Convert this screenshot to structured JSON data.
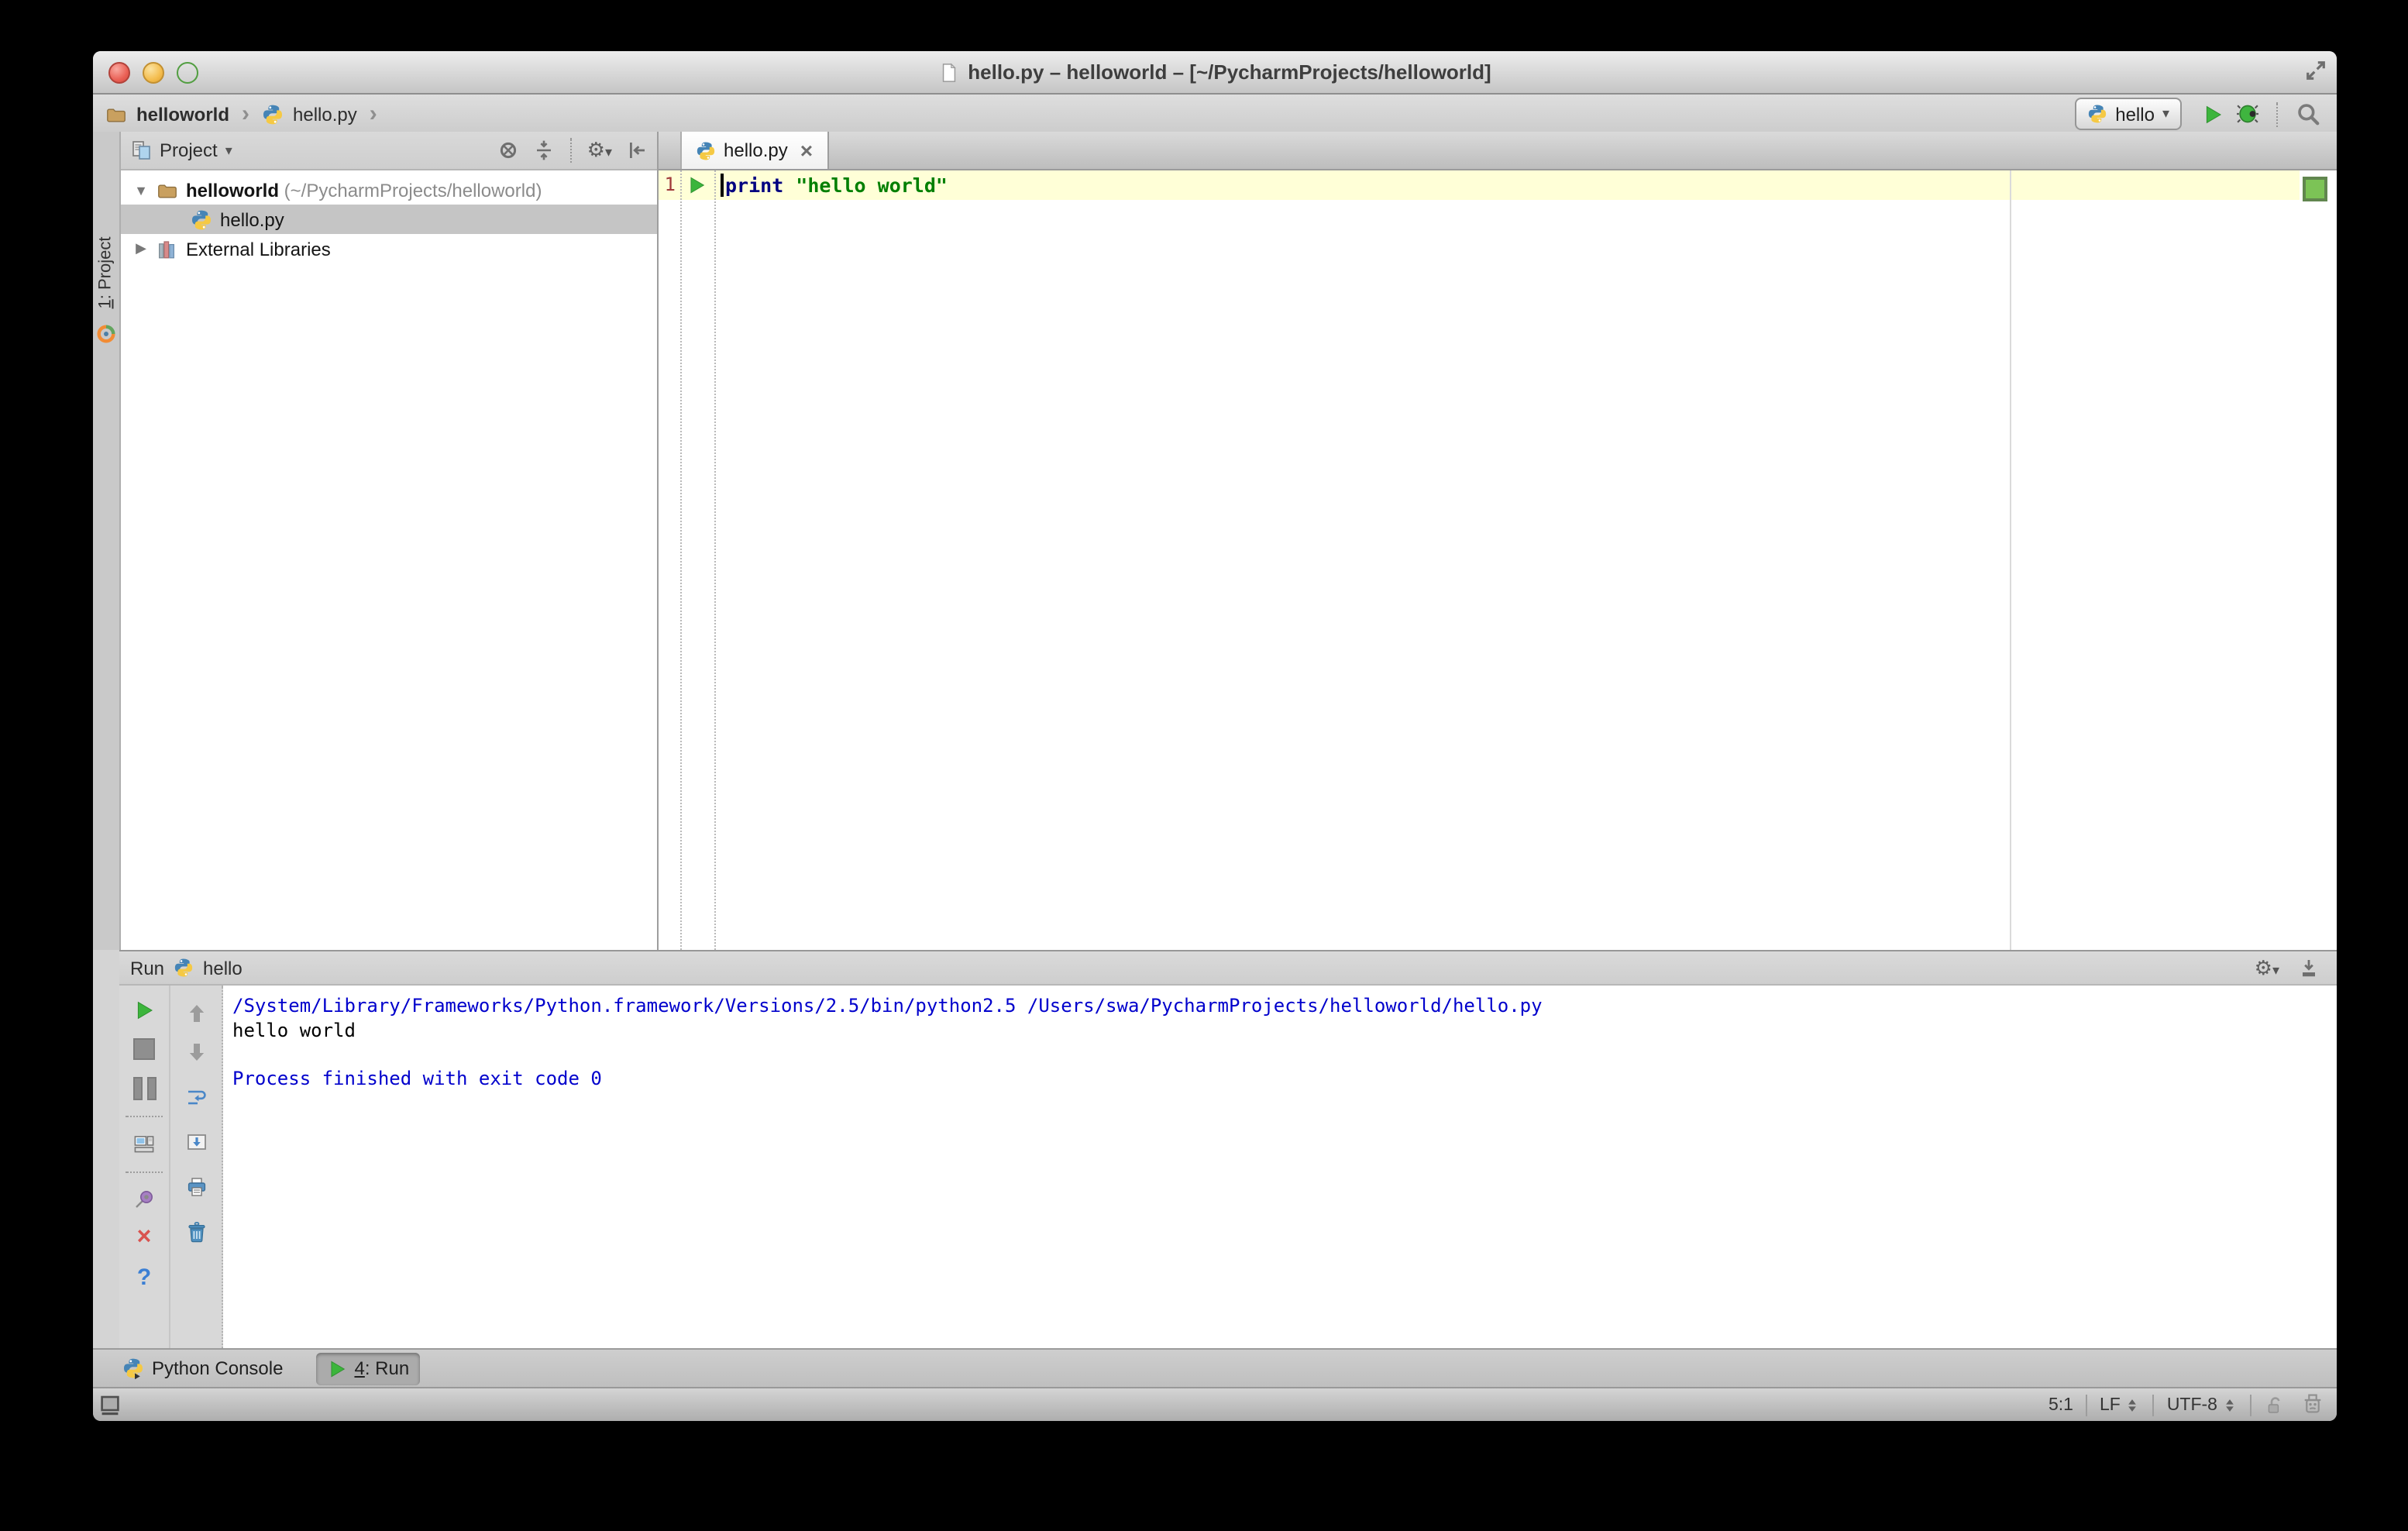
{
  "window": {
    "title": "hello.py – helloworld – [~/PycharmProjects/helloworld]"
  },
  "breadcrumb": {
    "project": "helloworld",
    "file": "hello.py"
  },
  "main_toolbar": {
    "run_config": "hello"
  },
  "tool_stripe": {
    "mnemonic": "1",
    "label": ": Project"
  },
  "project_panel": {
    "title": "Project",
    "tree": [
      {
        "name": "helloworld",
        "path": " (~/PycharmProjects/helloworld)"
      },
      {
        "name": "hello.py"
      },
      {
        "name": "External Libraries"
      }
    ]
  },
  "editor": {
    "tab_label": "hello.py",
    "line_number": "1",
    "code_keyword": "print",
    "code_string": "\"hello world\""
  },
  "run_panel": {
    "title": "Run",
    "config_name": "hello",
    "console_lines": [
      {
        "text": "/System/Library/Frameworks/Python.framework/Versions/2.5/bin/python2.5 /Users/swa/PycharmProjects/helloworld/hello.py",
        "color": "#0000CC"
      },
      {
        "text": "hello world",
        "color": "#000000"
      },
      {
        "text": "",
        "color": ""
      },
      {
        "text": "Process finished with exit code 0",
        "color": "#0000CC"
      }
    ]
  },
  "tool_buttons": {
    "python_console": "Python Console",
    "run_mnemonic": "4",
    "run_label": ": Run"
  },
  "status_bar": {
    "caret_position": "5:1",
    "line_separator": "LF",
    "encoding": "UTF-8"
  },
  "icons": {
    "chevron": "›",
    "dropdown": "▾",
    "expanded": "▼",
    "collapsed": "▶",
    "close_tab": "×",
    "close_panel": "×",
    "help": "?",
    "gear": "⚙"
  },
  "colors": {
    "keyword": "#000080",
    "string": "#007F00",
    "current_line": "#FFFFD7",
    "console_info": "#0000CC",
    "run_green": "#3CB53C",
    "indicator_green": "#7CC356",
    "selection_gray": "#C5C5C5"
  }
}
